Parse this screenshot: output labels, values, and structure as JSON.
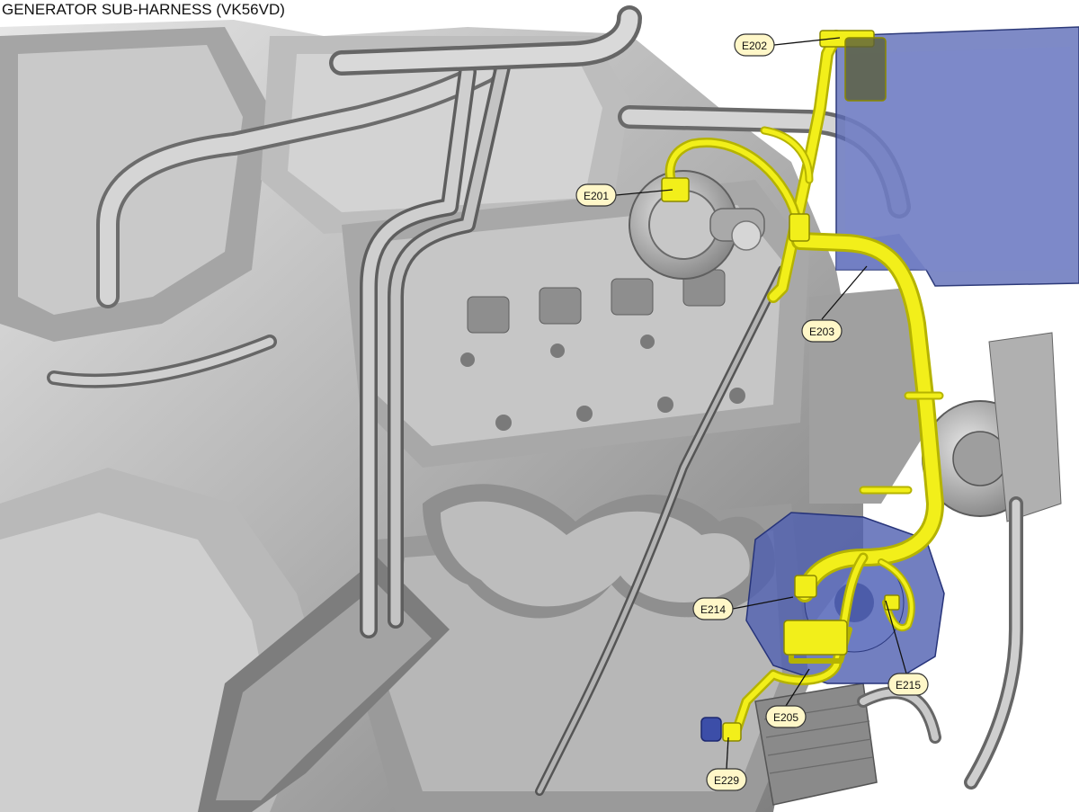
{
  "title": "GENERATOR SUB-HARNESS (VK56VD)",
  "colors": {
    "harness": "#f2ef1a",
    "harness_dark": "#b5b300",
    "engine_light": "#d8d8d8",
    "engine_mid": "#a9a9a9",
    "engine_dark": "#6d6d6d",
    "transparent_part": "#5a69b6",
    "callout_fill": "#fff7c8",
    "callout_stroke": "#333333"
  },
  "connectors": [
    {
      "id": "e202",
      "label": "E202"
    },
    {
      "id": "e201",
      "label": "E201"
    },
    {
      "id": "e203",
      "label": "E203"
    },
    {
      "id": "e214",
      "label": "E214"
    },
    {
      "id": "e215",
      "label": "E215"
    },
    {
      "id": "e205",
      "label": "E205"
    },
    {
      "id": "e229",
      "label": "E229"
    }
  ]
}
